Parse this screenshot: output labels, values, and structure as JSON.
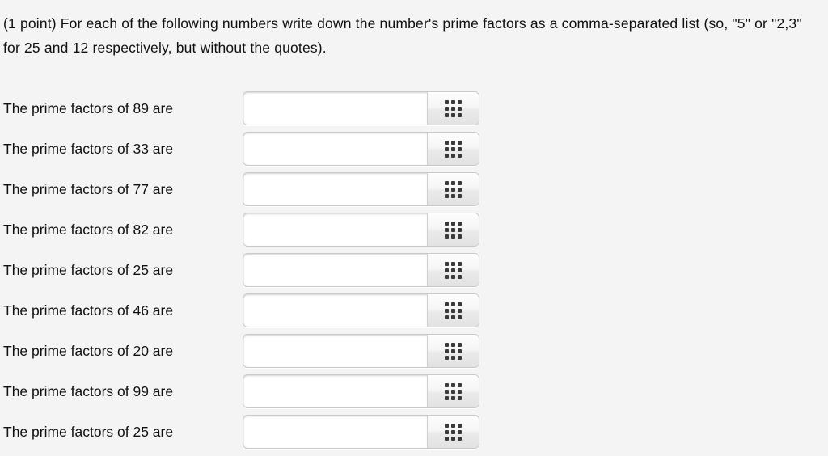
{
  "question": {
    "text": "(1 point) For each of the following numbers write down the number's prime factors as a comma-separated list (so, \"5\" or \"2,3\" for 25 and 12 respectively, but without the quotes).",
    "points_label": "(1 point)"
  },
  "answer_input": {
    "placeholder": "",
    "value": ""
  },
  "keypad_button": {
    "icon": "keypad-grid-icon",
    "label": ""
  },
  "colors": {
    "page_background": "#f4f4f4",
    "text": "#111111",
    "input_background": "#ffffff",
    "input_border": "#c9c9c9",
    "button_face": "#f0f0f0",
    "icon_dot": "#3a3a3a"
  },
  "rows": [
    {
      "label": "The prime factors of 89 are",
      "number": 89,
      "value": ""
    },
    {
      "label": "The prime factors of 33 are",
      "number": 33,
      "value": ""
    },
    {
      "label": "The prime factors of 77 are",
      "number": 77,
      "value": ""
    },
    {
      "label": "The prime factors of 82 are",
      "number": 82,
      "value": ""
    },
    {
      "label": "The prime factors of 25 are",
      "number": 25,
      "value": ""
    },
    {
      "label": "The prime factors of 46 are",
      "number": 46,
      "value": ""
    },
    {
      "label": "The prime factors of 20 are",
      "number": 20,
      "value": ""
    },
    {
      "label": "The prime factors of 99 are",
      "number": 99,
      "value": ""
    },
    {
      "label": "The prime factors of 25 are",
      "number": 25,
      "value": ""
    }
  ]
}
